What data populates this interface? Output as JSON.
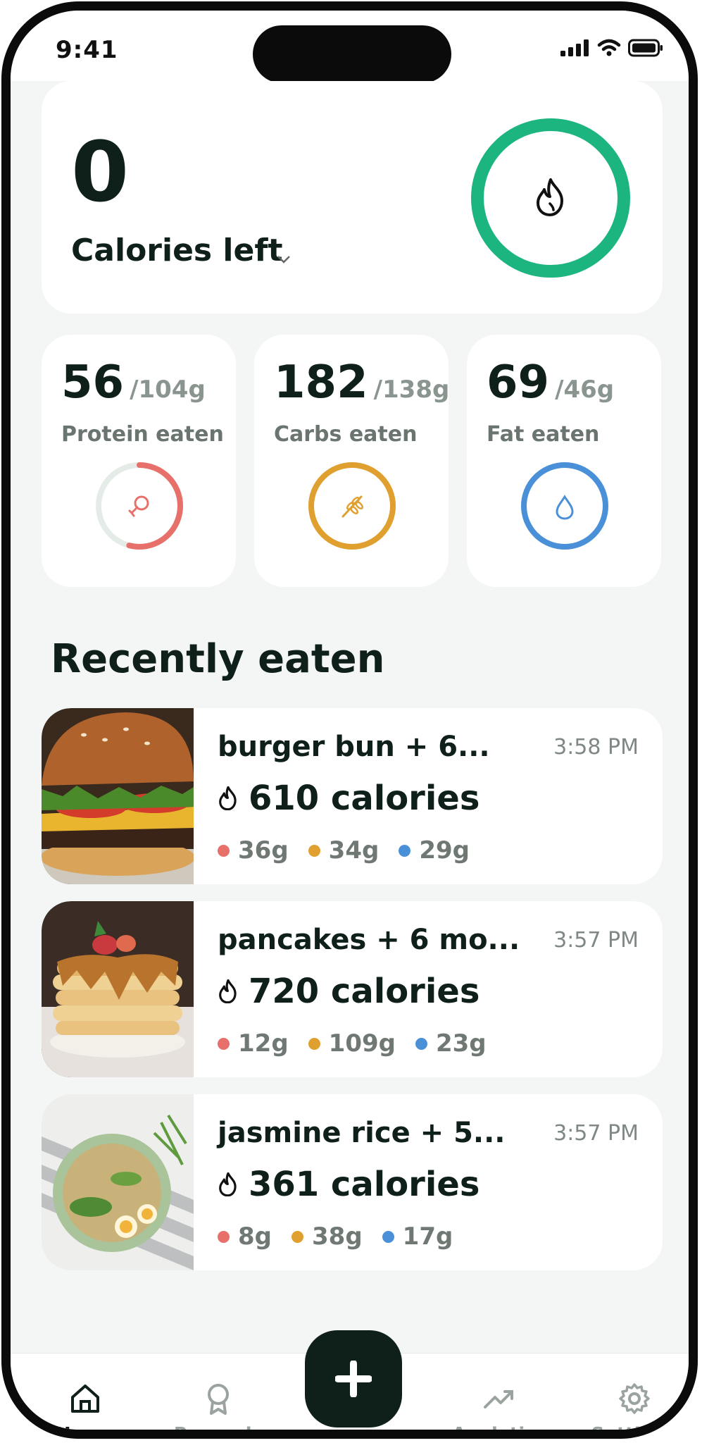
{
  "status_bar": {
    "time": "9:41"
  },
  "calories": {
    "value": "0",
    "label": "Calories left"
  },
  "macros": [
    {
      "name": "protein",
      "value": "56",
      "total": "/104g",
      "label": "Protein eaten",
      "color": "#e8706a",
      "progress": 0.54
    },
    {
      "name": "carbs",
      "value": "182",
      "total": "/138g",
      "label": "Carbs eaten",
      "color": "#e0a030",
      "progress": 1.0
    },
    {
      "name": "fat",
      "value": "69",
      "total": "/46g",
      "label": "Fat eaten",
      "color": "#4a90d9",
      "progress": 1.0
    }
  ],
  "recent": {
    "title": "Recently eaten",
    "items": [
      {
        "name": "burger bun + 6...",
        "time": "3:58 PM",
        "calories": "610 calories",
        "protein": "36g",
        "carbs": "34g",
        "fat": "29g"
      },
      {
        "name": "pancakes + 6 mo...",
        "time": "3:57 PM",
        "calories": "720 calories",
        "protein": "12g",
        "carbs": "109g",
        "fat": "23g"
      },
      {
        "name": "jasmine rice + 5...",
        "time": "3:57 PM",
        "calories": "361 calories",
        "protein": "8g",
        "carbs": "38g",
        "fat": "17g"
      }
    ]
  },
  "tabs": [
    {
      "label": "Home",
      "icon": "home-icon",
      "active": true
    },
    {
      "label": "Rewards",
      "icon": "award-icon",
      "active": false
    },
    {
      "label": "Analytics",
      "icon": "trend-icon",
      "active": false
    },
    {
      "label": "Settings",
      "icon": "gear-icon",
      "active": false
    }
  ],
  "colors": {
    "accent": "#1db57f",
    "dark": "#0f1f19",
    "protein": "#e8706a",
    "carbs": "#e0a030",
    "fat": "#4a90d9"
  }
}
